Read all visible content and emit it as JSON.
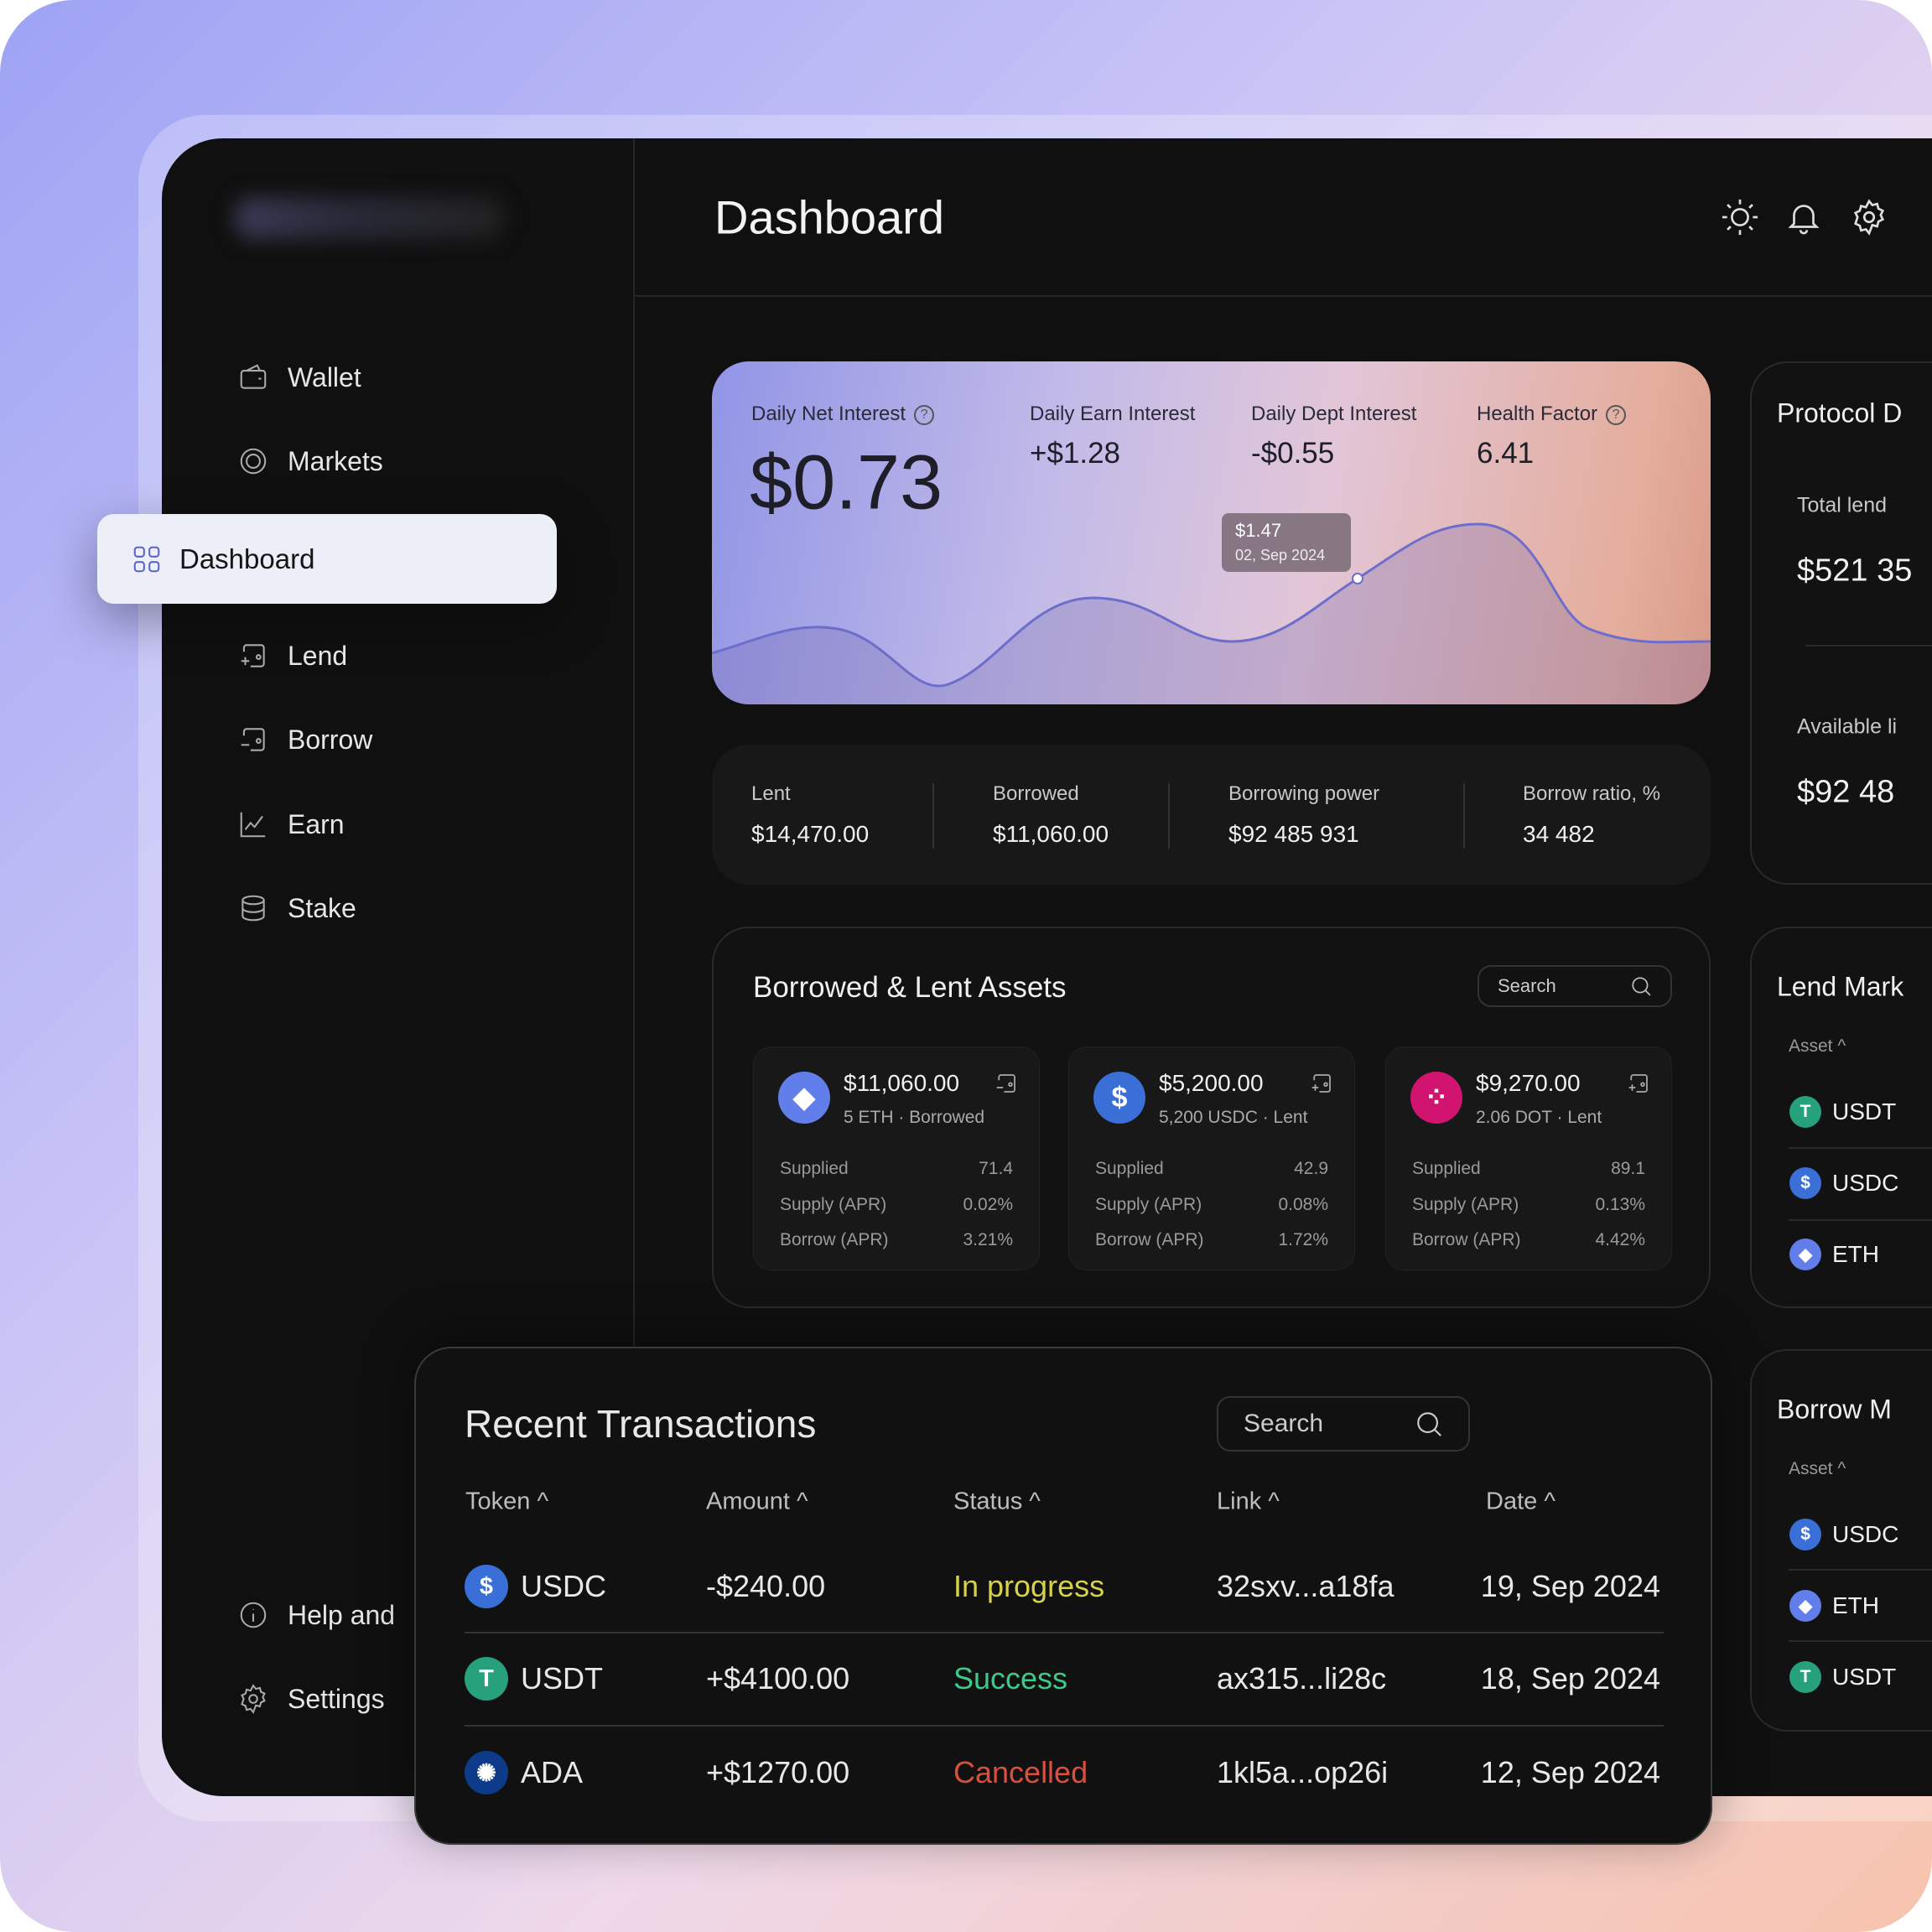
{
  "sidebar": {
    "items": [
      {
        "label": "Wallet",
        "icon": "wallet-icon"
      },
      {
        "label": "Markets",
        "icon": "markets-icon"
      },
      {
        "label": "Dashboard",
        "icon": "grid-icon",
        "active": true
      },
      {
        "label": "Lend",
        "icon": "lend-icon"
      },
      {
        "label": "Borrow",
        "icon": "borrow-icon"
      },
      {
        "label": "Earn",
        "icon": "chart-line-icon"
      },
      {
        "label": "Stake",
        "icon": "database-icon"
      }
    ],
    "bottom": [
      {
        "label": "Help and",
        "icon": "info-icon"
      },
      {
        "label": "Settings",
        "icon": "gear-icon"
      }
    ]
  },
  "header": {
    "title": "Dashboard",
    "icons": [
      "sun-icon",
      "bell-icon",
      "gear-icon"
    ]
  },
  "interest": {
    "net_label": "Daily Net Interest",
    "net_value": "$0.73",
    "earn_label": "Daily Earn Interest",
    "earn_value": "+$1.28",
    "dept_label": "Daily Dept Interest",
    "dept_value": "-$0.55",
    "health_label": "Health Factor",
    "health_value": "6.41",
    "tooltip_value": "$1.47",
    "tooltip_date": "02, Sep 2024"
  },
  "stats": [
    {
      "label": "Lent",
      "value": "$14,470.00"
    },
    {
      "label": "Borrowed",
      "value": "$11,060.00"
    },
    {
      "label": "Borrowing power",
      "value": "$92 485 931"
    },
    {
      "label": "Borrow ratio, %",
      "value": "34 482"
    }
  ],
  "assets": {
    "title": "Borrowed & Lent Assets",
    "search_placeholder": "Search",
    "cards": [
      {
        "amount": "$11,060.00",
        "sub": "5 ETH · Borrowed",
        "coin": "ETH",
        "color": "#5b6bd6",
        "rows": [
          [
            "Supplied",
            "71.4"
          ],
          [
            "Supply (APR)",
            "0.02%"
          ],
          [
            "Borrow (APR)",
            "3.21%"
          ]
        ]
      },
      {
        "amount": "$5,200.00",
        "sub": "5,200 USDC · Lent",
        "coin": "USDC",
        "color": "#2f5fb3",
        "rows": [
          [
            "Supplied",
            "42.9"
          ],
          [
            "Supply (APR)",
            "0.08%"
          ],
          [
            "Borrow (APR)",
            "1.72%"
          ]
        ]
      },
      {
        "amount": "$9,270.00",
        "sub": "2.06 DOT · Lent",
        "coin": "DOT",
        "color": "#d1146f",
        "rows": [
          [
            "Supplied",
            "89.1"
          ],
          [
            "Supply (APR)",
            "0.13%"
          ],
          [
            "Borrow (APR)",
            "4.42%"
          ]
        ]
      }
    ]
  },
  "protocol": {
    "title": "Protocol D",
    "total_label": "Total lend",
    "total_value": "$521 35",
    "avail_label": "Available li",
    "avail_value": "$92 48"
  },
  "lend_market": {
    "title": "Lend Mark",
    "col": "Asset ^",
    "items": [
      "USDT",
      "USDC",
      "ETH"
    ]
  },
  "borrow_market": {
    "title": "Borrow M",
    "col": "Asset ^",
    "items": [
      "USDC",
      "ETH",
      "USDT"
    ]
  },
  "transactions": {
    "title": "Recent Transactions",
    "search_placeholder": "Search",
    "columns": [
      "Token ^",
      "Amount ^",
      "Status ^",
      "Link ^",
      "Date ^"
    ],
    "rows": [
      {
        "token": "USDC",
        "amount": "-$240.00",
        "status": "In progress",
        "status_color": "#d6d24a",
        "link": "32sxv...a18fa",
        "date": "19, Sep 2024"
      },
      {
        "token": "USDT",
        "amount": "+$4100.00",
        "status": "Success",
        "status_color": "#3cc98a",
        "link": "ax315...li28c",
        "date": "18, Sep 2024"
      },
      {
        "token": "ADA",
        "amount": "+$1270.00",
        "status": "Cancelled",
        "status_color": "#d9503f",
        "link": "1kl5a...op26i",
        "date": "12, Sep 2024"
      }
    ]
  },
  "coin_colors": {
    "USDC": "#3a6fd8",
    "USDT": "#26a17b",
    "ETH": "#627eea",
    "ADA": "#0d3b8a",
    "DOT": "#d1146f"
  }
}
